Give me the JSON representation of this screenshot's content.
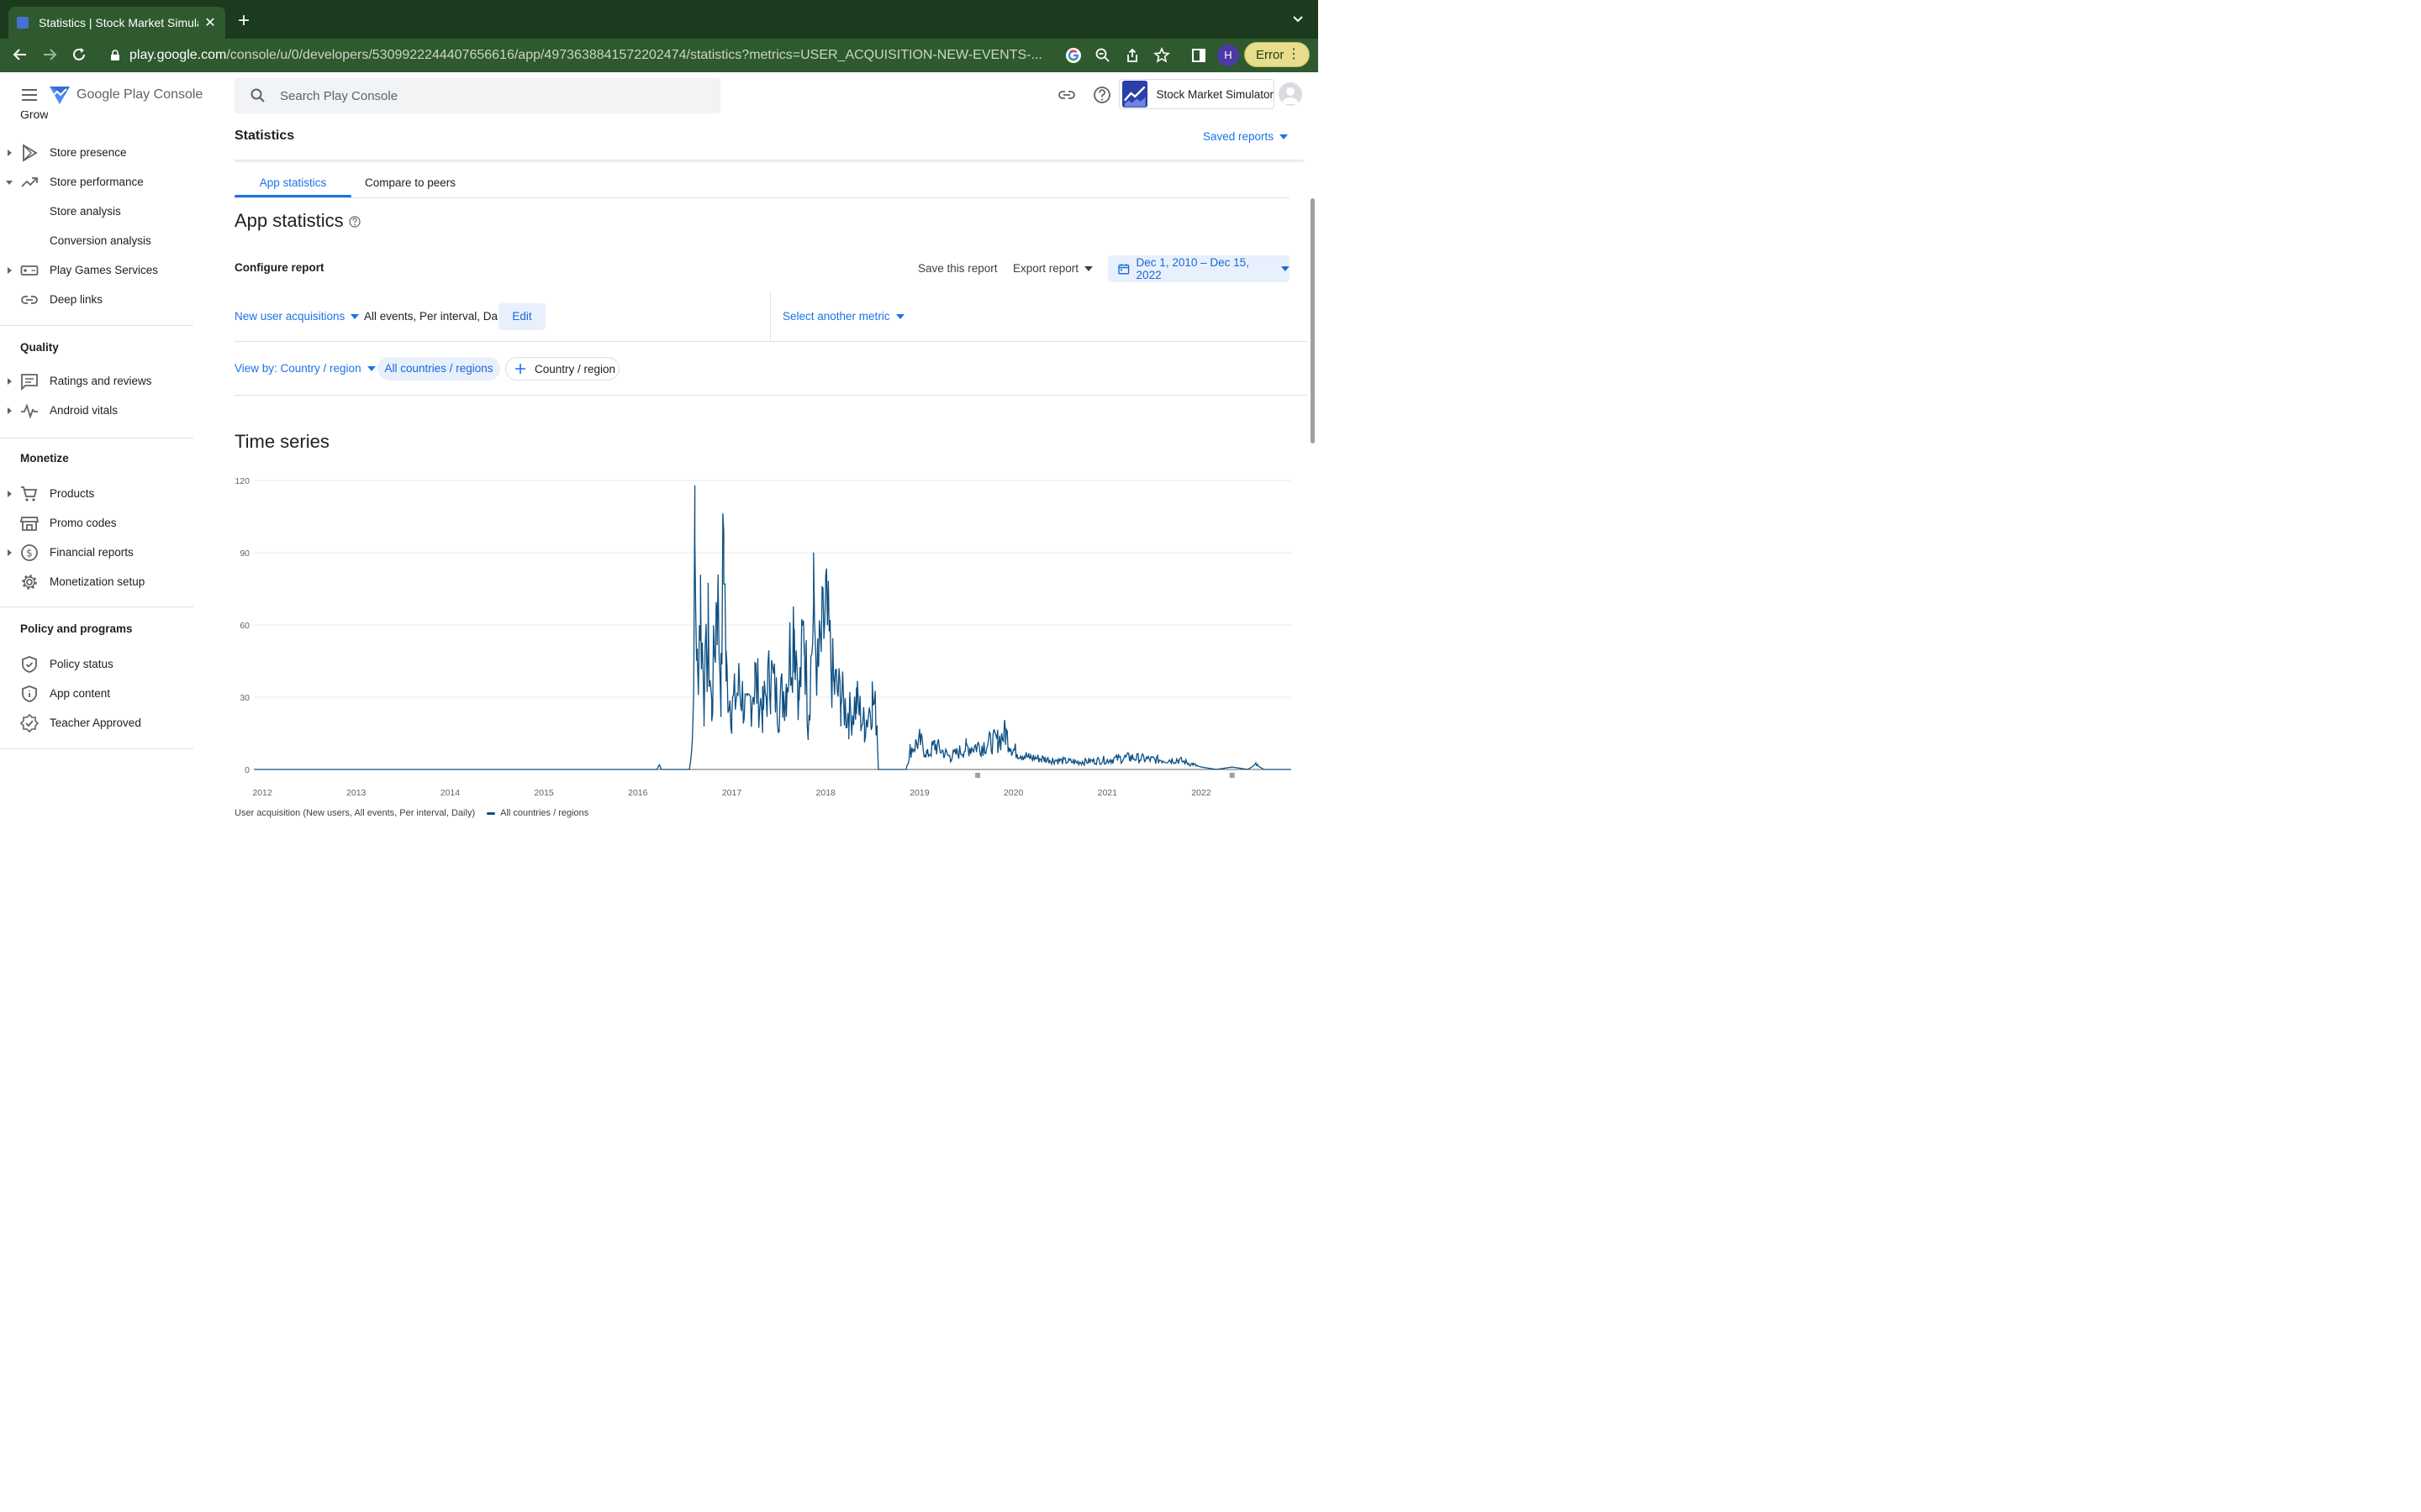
{
  "browser": {
    "tab_title": "Statistics | Stock Market Simula",
    "url_domain": "play.google.com",
    "url_path": "/console/u/0/developers/5309922244407656616/app/4973638841572202474/statistics?metrics=USER_ACQUISITION-NEW-EVENTS-...",
    "profile_initial": "H",
    "error_label": "Error"
  },
  "brand": {
    "name_prefix": "Google Play",
    "name_suffix": "Console"
  },
  "sidebar": {
    "cut_section": "Grow",
    "grow_items": [
      {
        "label": "Store presence",
        "icon": "play-icon",
        "expandable": "collapsed"
      },
      {
        "label": "Store performance",
        "icon": "trending-up-icon",
        "expandable": "expanded"
      },
      {
        "label": "Store analysis",
        "icon": "",
        "expandable": "none"
      },
      {
        "label": "Conversion analysis",
        "icon": "",
        "expandable": "none"
      },
      {
        "label": "Play Games Services",
        "icon": "gamepad-icon",
        "expandable": "collapsed"
      },
      {
        "label": "Deep links",
        "icon": "link-icon",
        "expandable": "none"
      }
    ],
    "quality_title": "Quality",
    "quality_items": [
      {
        "label": "Ratings and reviews",
        "icon": "reviews-icon",
        "expandable": "collapsed"
      },
      {
        "label": "Android vitals",
        "icon": "vitals-icon",
        "expandable": "collapsed"
      }
    ],
    "monetize_title": "Monetize",
    "monetize_items": [
      {
        "label": "Products",
        "icon": "cart-icon",
        "expandable": "collapsed"
      },
      {
        "label": "Promo codes",
        "icon": "store-icon",
        "expandable": "none"
      },
      {
        "label": "Financial reports",
        "icon": "dollar-icon",
        "expandable": "collapsed"
      },
      {
        "label": "Monetization setup",
        "icon": "gear-icon",
        "expandable": "none"
      }
    ],
    "policy_title": "Policy and programs",
    "policy_items": [
      {
        "label": "Policy status",
        "icon": "shield-check-icon",
        "expandable": "none"
      },
      {
        "label": "App content",
        "icon": "shield-info-icon",
        "expandable": "none"
      },
      {
        "label": "Teacher Approved",
        "icon": "badge-icon",
        "expandable": "none"
      }
    ]
  },
  "header": {
    "search_placeholder": "Search Play Console",
    "app_name": "Stock Market Simulator"
  },
  "page": {
    "title": "Statistics",
    "saved_reports": "Saved reports",
    "tabs": [
      "App statistics",
      "Compare to peers"
    ],
    "section_title": "App statistics",
    "configure_report": "Configure report",
    "save_report": "Save this report",
    "export_report": "Export report",
    "date_range": "Dec 1, 2010 – Dec 15, 2022",
    "metric": "New user acquisitions",
    "metric_desc": "All events, Per interval, Daily",
    "edit": "Edit",
    "select_metric": "Select another metric",
    "view_by": "View by: Country / region",
    "chip_all": "All countries / regions",
    "chip_add": "Country / region",
    "time_series_title": "Time series",
    "legend_metric": "User acquisition (New users, All events, Per interval, Daily)",
    "legend_series": "All countries / regions"
  },
  "colors": {
    "accent": "#1a73e8",
    "series": "#0d4f82",
    "chrome": "#2f5a2f"
  },
  "chart_data": {
    "type": "line",
    "y_ticks": [
      "120",
      "90",
      "60",
      "30",
      "0"
    ],
    "x_ticks": [
      "2012",
      "2013",
      "2014",
      "2015",
      "2016",
      "2017",
      "2018",
      "2019",
      "2020",
      "2021",
      "2022"
    ],
    "ylim": [
      0,
      120
    ],
    "series": [
      {
        "name": "All countries / regions",
        "points": [
          [
            "2011-12-01",
            0
          ],
          [
            "2016-03-15",
            0
          ],
          [
            "2016-03-25",
            2
          ],
          [
            "2016-04-01",
            0
          ],
          [
            "2016-07-20",
            0
          ],
          [
            "2016-08-01",
            14
          ],
          [
            "2016-08-10",
            88
          ],
          [
            "2016-08-20",
            40
          ],
          [
            "2016-09-01",
            70
          ],
          [
            "2016-09-15",
            30
          ],
          [
            "2016-10-01",
            55
          ],
          [
            "2016-10-15",
            25
          ],
          [
            "2016-11-05",
            75
          ],
          [
            "2016-11-20",
            35
          ],
          [
            "2016-12-01",
            101
          ],
          [
            "2016-12-10",
            40
          ],
          [
            "2017-01-01",
            25
          ],
          [
            "2017-02-01",
            35
          ],
          [
            "2017-03-01",
            22
          ],
          [
            "2017-04-01",
            38
          ],
          [
            "2017-05-01",
            24
          ],
          [
            "2017-06-01",
            40
          ],
          [
            "2017-07-01",
            26
          ],
          [
            "2017-08-01",
            36
          ],
          [
            "2017-09-01",
            64
          ],
          [
            "2017-09-20",
            30
          ],
          [
            "2017-10-10",
            60
          ],
          [
            "2017-10-25",
            20
          ],
          [
            "2017-11-15",
            66
          ],
          [
            "2017-12-01",
            40
          ],
          [
            "2018-01-01",
            64
          ],
          [
            "2018-02-01",
            35
          ],
          [
            "2018-03-01",
            30
          ],
          [
            "2018-04-01",
            22
          ],
          [
            "2018-05-01",
            28
          ],
          [
            "2018-06-01",
            18
          ],
          [
            "2018-07-01",
            30
          ],
          [
            "2018-07-20",
            20
          ],
          [
            "2018-07-25",
            0
          ],
          [
            "2018-11-10",
            0
          ],
          [
            "2018-11-25",
            8
          ],
          [
            "2019-01-01",
            12
          ],
          [
            "2019-02-01",
            6
          ],
          [
            "2019-03-01",
            10
          ],
          [
            "2019-05-01",
            5
          ],
          [
            "2019-07-01",
            9
          ],
          [
            "2019-09-01",
            10
          ],
          [
            "2019-11-01",
            12
          ],
          [
            "2019-12-01",
            15
          ],
          [
            "2020-01-01",
            8
          ],
          [
            "2020-03-01",
            5
          ],
          [
            "2020-06-01",
            4
          ],
          [
            "2020-09-01",
            3
          ],
          [
            "2021-01-01",
            4
          ],
          [
            "2021-04-01",
            5
          ],
          [
            "2021-07-01",
            4
          ],
          [
            "2021-10-01",
            4
          ],
          [
            "2021-12-01",
            2
          ],
          [
            "2022-01-01",
            1
          ],
          [
            "2022-03-01",
            0
          ],
          [
            "2022-05-01",
            1
          ],
          [
            "2022-07-01",
            0
          ],
          [
            "2022-08-01",
            2
          ],
          [
            "2022-09-01",
            0
          ],
          [
            "2022-12-15",
            0
          ]
        ]
      }
    ]
  }
}
